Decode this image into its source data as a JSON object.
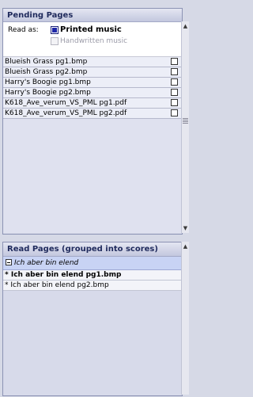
{
  "pending": {
    "title": "Pending Pages",
    "read_as_label": "Read as:",
    "options": [
      {
        "label": "Printed music",
        "selected": true
      },
      {
        "label": "Handwritten music",
        "selected": false,
        "disabled": true
      }
    ],
    "files": [
      "Blueish Grass pg1.bmp",
      "Blueish Grass pg2.bmp",
      "Harry's Boogie pg1.bmp",
      "Harry's Boogie pg2.bmp",
      "K618_Ave_verum_VS_PML pg1.pdf",
      "K618_Ave_verum_VS_PML pg2.pdf"
    ]
  },
  "read": {
    "title": "Read Pages (grouped into scores)",
    "group_label": "Ich aber bin elend",
    "pages": [
      {
        "label": "* Ich aber bin elend pg1.bmp",
        "bold": true
      },
      {
        "label": "* Ich aber bin elend pg2.bmp",
        "bold": false
      }
    ]
  },
  "icons": {
    "scroll_up": "up-arrow-icon",
    "scroll_down": "down-arrow-icon",
    "collapse": "minus-box-icon"
  }
}
